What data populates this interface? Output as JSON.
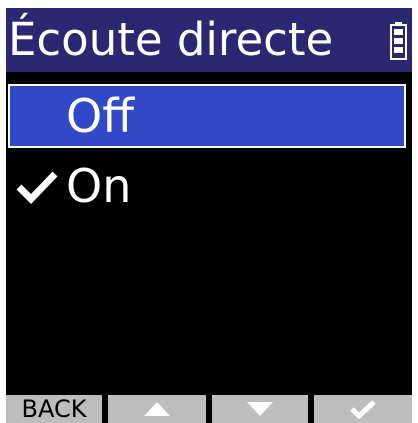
{
  "header": {
    "title": "Écoute directe",
    "battery_icon": "battery-icon"
  },
  "menu": {
    "items": [
      {
        "label": "Off",
        "highlighted": true,
        "checked": false
      },
      {
        "label": "On",
        "highlighted": false,
        "checked": true
      }
    ],
    "check_icon": "checkmark-icon"
  },
  "softkeys": {
    "back_label": "BACK",
    "up_icon": "triangle-up-icon",
    "down_icon": "triangle-down-icon",
    "ok_icon": "checkmark-icon"
  },
  "colors": {
    "title_bar": "#2b2770",
    "highlight": "#2f49c8",
    "background": "#000000",
    "text": "#ffffff",
    "softkey": "#bdbdbd"
  }
}
